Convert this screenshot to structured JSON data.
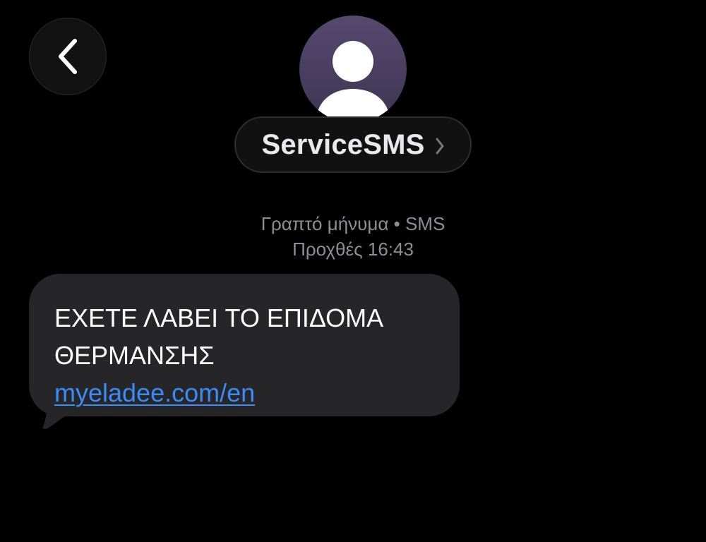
{
  "header": {
    "back_icon": "chevron-left-icon",
    "avatar_icon": "person-silhouette-icon",
    "contact_name": "ServiceSMS",
    "contact_chevron_icon": "chevron-right-icon"
  },
  "conversation": {
    "message_type": "Γραπτό μήνυμα • SMS",
    "timestamp": "Προχθές 16:43",
    "messages": [
      {
        "direction": "incoming",
        "lines": [
          "ΕΧΕΤΕ ΛΑΒΕΙ ΤΟ ΕΠΙΔΟΜΑ",
          "ΘΕΡΜΑΝΣΗΣ"
        ],
        "link": "myeladee.com/en"
      }
    ]
  },
  "colors": {
    "background": "#000000",
    "incoming_bubble": "#262628",
    "link": "#3b8cf5",
    "avatar": "#4a4062",
    "secondary_text": "#8e8e93"
  }
}
